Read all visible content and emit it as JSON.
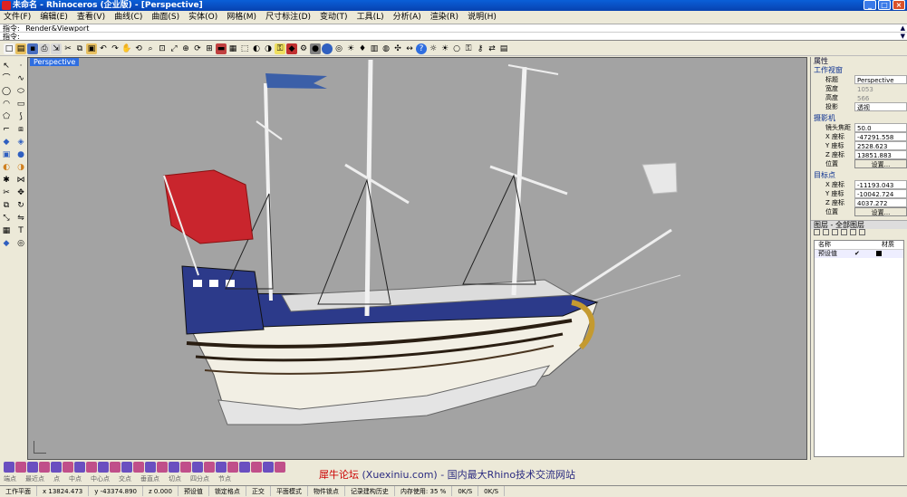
{
  "window": {
    "title": "未命名 - Rhinoceros (企业版) - [Perspective]",
    "buttons": [
      "_",
      "□",
      "×"
    ]
  },
  "menu": [
    "文件(F)",
    "编辑(E)",
    "查看(V)",
    "曲线(C)",
    "曲面(S)",
    "实体(O)",
    "网格(M)",
    "尺寸标注(D)",
    "变动(T)",
    "工具(L)",
    "分析(A)",
    "渲染(R)",
    "说明(H)"
  ],
  "command": {
    "history": "指令: _Render&Viewport",
    "prompt": "指令:",
    "value": ""
  },
  "viewport": {
    "label": "Perspective"
  },
  "properties": {
    "header": "属性",
    "section_view": "工作视窗",
    "rows_view": [
      {
        "k": "标题",
        "v": "Perspective"
      },
      {
        "k": "宽度",
        "v": "1053"
      },
      {
        "k": "高度",
        "v": "566"
      },
      {
        "k": "投影",
        "v": "透视"
      }
    ],
    "section_camera": "摄影机",
    "rows_camera": [
      {
        "k": "镜头焦距",
        "v": "50.0"
      },
      {
        "k": "X 座标",
        "v": "-47291.558"
      },
      {
        "k": "Y 座标",
        "v": "2528.623"
      },
      {
        "k": "Z 座标",
        "v": "13851.883"
      },
      {
        "k": "位置",
        "v": "设置..."
      }
    ],
    "section_target": "目标点",
    "rows_target": [
      {
        "k": "X 座标",
        "v": "-11193.043"
      },
      {
        "k": "Y 座标",
        "v": "-10042.724"
      },
      {
        "k": "Z 座标",
        "v": "4037.272"
      },
      {
        "k": "位置",
        "v": "设置..."
      }
    ]
  },
  "layers": {
    "header": "图层 - 全部图层",
    "col_name": "名称",
    "col_mat": "材质",
    "row_name": "预设值",
    "row_check": "✔"
  },
  "osnap": [
    "端点",
    "最近点",
    "点",
    "中点",
    "中心点",
    "交点",
    "垂直点",
    "切点",
    "四分点",
    "节点"
  ],
  "watermark": {
    "part1": "犀牛论坛",
    "part2": "(Xuexiniu.com) - 国内最大Rhino技术交流网站"
  },
  "status": {
    "plane": "工作平面",
    "x": "x 13824.473",
    "y": "y -43374.890",
    "z": "z 0.000",
    "layer": "预设值",
    "grid": "锁定格点",
    "ortho": "正交",
    "planar": "平面模式",
    "osnap": "物件锁点",
    "history": "记录建构历史",
    "memory": "内存使用: 35 %",
    "cpu1": "0K/S",
    "cpu2": "0K/S"
  }
}
